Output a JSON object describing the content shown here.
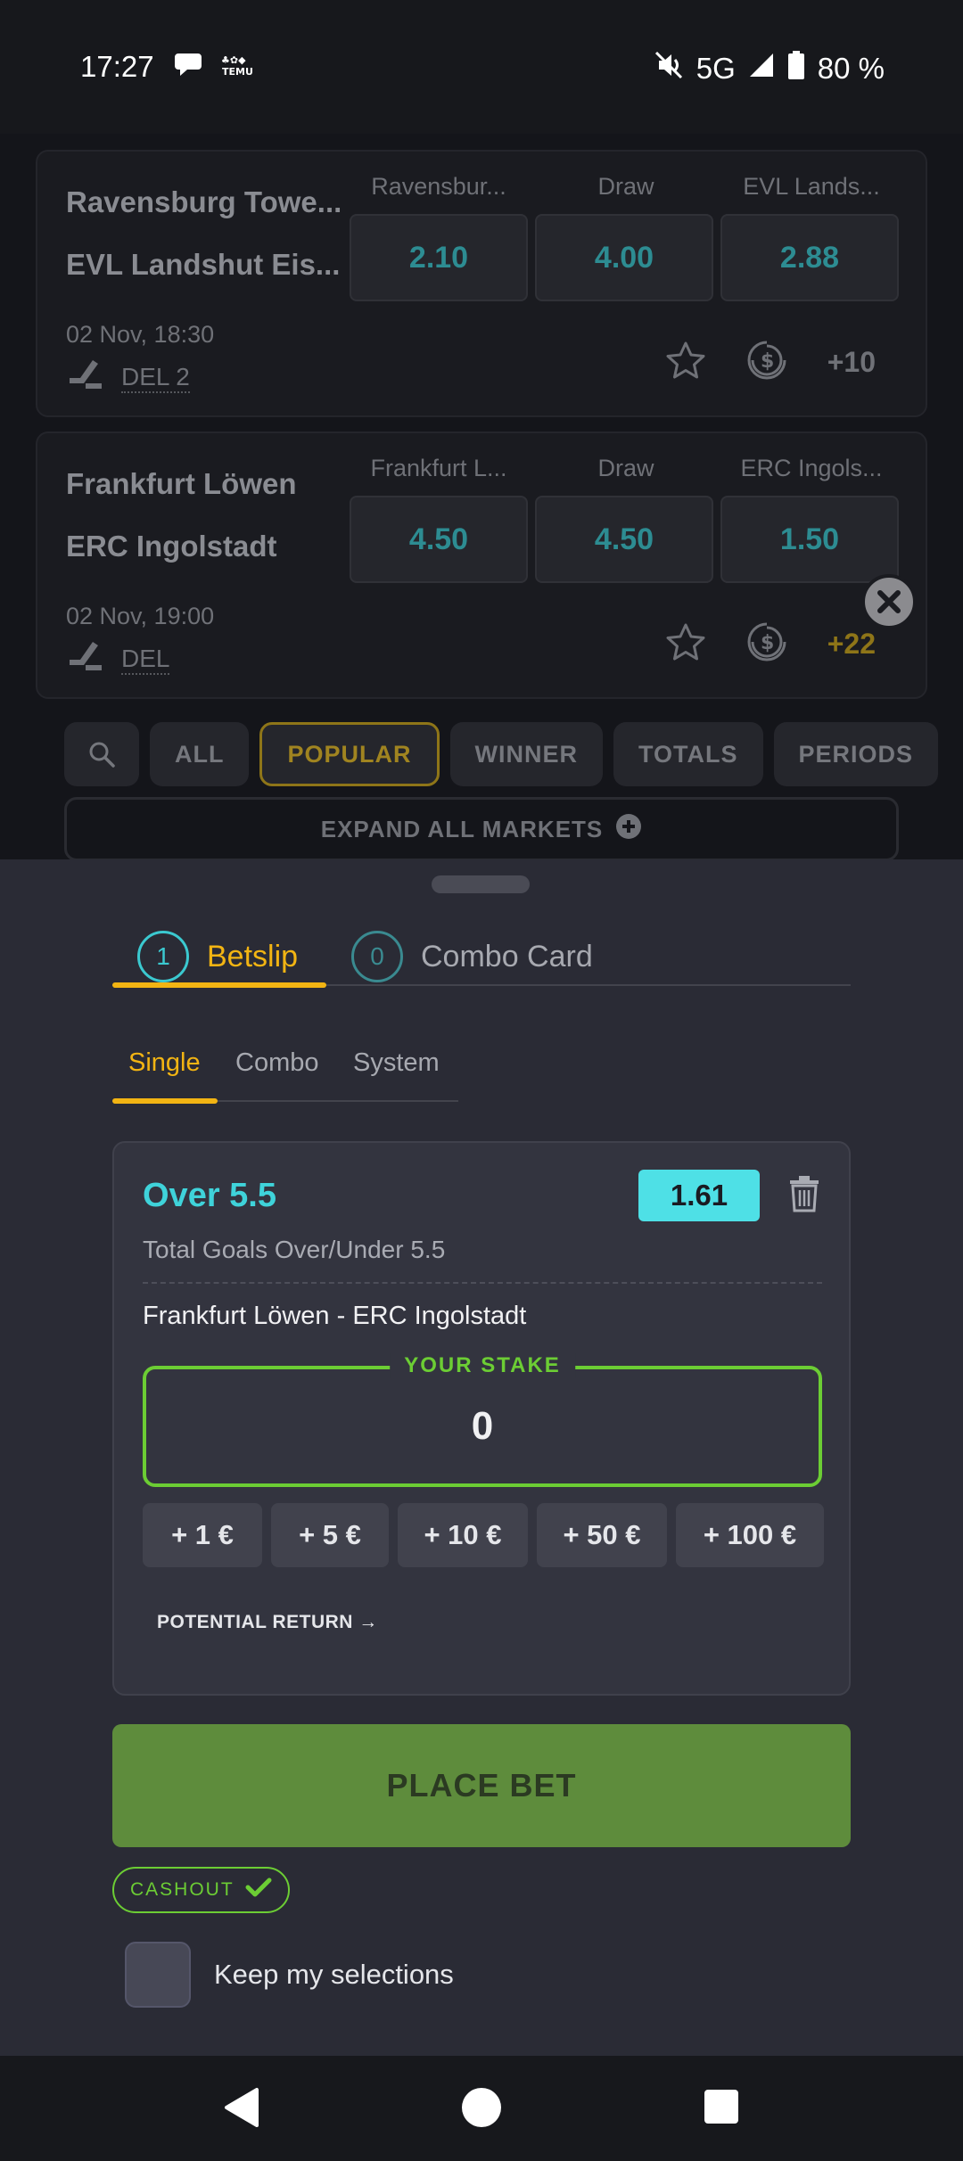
{
  "status_bar": {
    "time": "17:27",
    "network": "5G",
    "battery": "80 %"
  },
  "matches": [
    {
      "home": "Ravensburg Towe...",
      "away": "EVL Landshut Eis...",
      "col_labels": [
        "Ravensbur...",
        "Draw",
        "EVL Lands..."
      ],
      "odds": [
        "2.10",
        "4.00",
        "2.88"
      ],
      "datetime": "02 Nov,  18:30",
      "league": "DEL 2",
      "more_markets": "+10"
    },
    {
      "home": "Frankfurt Löwen",
      "away": "ERC Ingolstadt",
      "col_labels": [
        "Frankfurt L...",
        "Draw",
        "ERC Ingols..."
      ],
      "odds": [
        "4.50",
        "4.50",
        "1.50"
      ],
      "datetime": "02 Nov,  19:00",
      "league": "DEL",
      "more_markets": "+22"
    }
  ],
  "filters": [
    "ALL",
    "POPULAR",
    "WINNER",
    "TOTALS",
    "PERIODS"
  ],
  "expand_all": "EXPAND ALL MARKETS",
  "betslip": {
    "tabs": [
      {
        "count": "1",
        "label": "Betslip"
      },
      {
        "count": "0",
        "label": "Combo Card"
      }
    ],
    "subtabs": [
      "Single",
      "Combo",
      "System"
    ],
    "bet": {
      "selection": "Over 5.5",
      "odds": "1.61",
      "market": "Total Goals Over/Under 5.5",
      "match": "Frankfurt Löwen - ERC Ingolstadt"
    },
    "stake_label": "YOUR STAKE",
    "stake_value": "0",
    "quick_stakes": [
      "+ 1 €",
      "+ 5 €",
      "+ 10 €",
      "+ 50 €",
      "+ 100 €"
    ],
    "potential_return": "POTENTIAL RETURN →",
    "place_bet": "PLACE BET",
    "cashout": "CASHOUT",
    "keep_selections": "Keep my selections"
  },
  "colors": {
    "accent": "#f2b413",
    "odds_text": "#2d8c92",
    "selection": "#3fd3da",
    "stake_border": "#6ccd34",
    "place_bet_bg": "#5e8c3c"
  }
}
